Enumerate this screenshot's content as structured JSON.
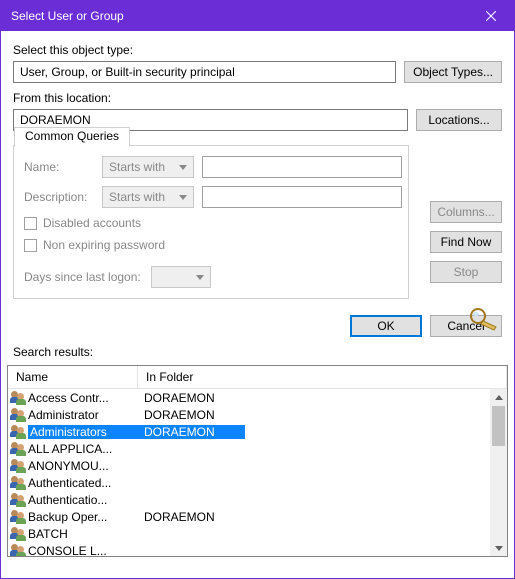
{
  "window": {
    "title": "Select User or Group"
  },
  "labels": {
    "object_type": "Select this object type:",
    "from_location": "From this location:",
    "common_queries": "Common Queries",
    "name": "Name:",
    "description": "Description:",
    "disabled": "Disabled accounts",
    "nonexpiring": "Non expiring password",
    "days_since": "Days since last logon:",
    "search_results": "Search results:"
  },
  "fields": {
    "object_type_value": "User, Group, or Built-in security principal",
    "location_value": "DORAEMON",
    "name_mode": "Starts with",
    "desc_mode": "Starts with"
  },
  "buttons": {
    "object_types": "Object Types...",
    "locations": "Locations...",
    "columns": "Columns...",
    "find_now": "Find Now",
    "stop": "Stop",
    "ok": "OK",
    "cancel": "Cancel"
  },
  "columns": {
    "name": "Name",
    "in_folder": "In Folder"
  },
  "results": [
    {
      "name": "Access Contr...",
      "folder": "DORAEMON",
      "selected": false
    },
    {
      "name": "Administrator",
      "folder": "DORAEMON",
      "selected": false
    },
    {
      "name": "Administrators",
      "folder": "DORAEMON",
      "selected": true
    },
    {
      "name": "ALL APPLICA...",
      "folder": "",
      "selected": false
    },
    {
      "name": "ANONYMOU...",
      "folder": "",
      "selected": false
    },
    {
      "name": "Authenticated...",
      "folder": "",
      "selected": false
    },
    {
      "name": "Authenticatio...",
      "folder": "",
      "selected": false
    },
    {
      "name": "Backup Oper...",
      "folder": "DORAEMON",
      "selected": false
    },
    {
      "name": "BATCH",
      "folder": "",
      "selected": false
    },
    {
      "name": "CONSOLE L...",
      "folder": "",
      "selected": false
    }
  ]
}
